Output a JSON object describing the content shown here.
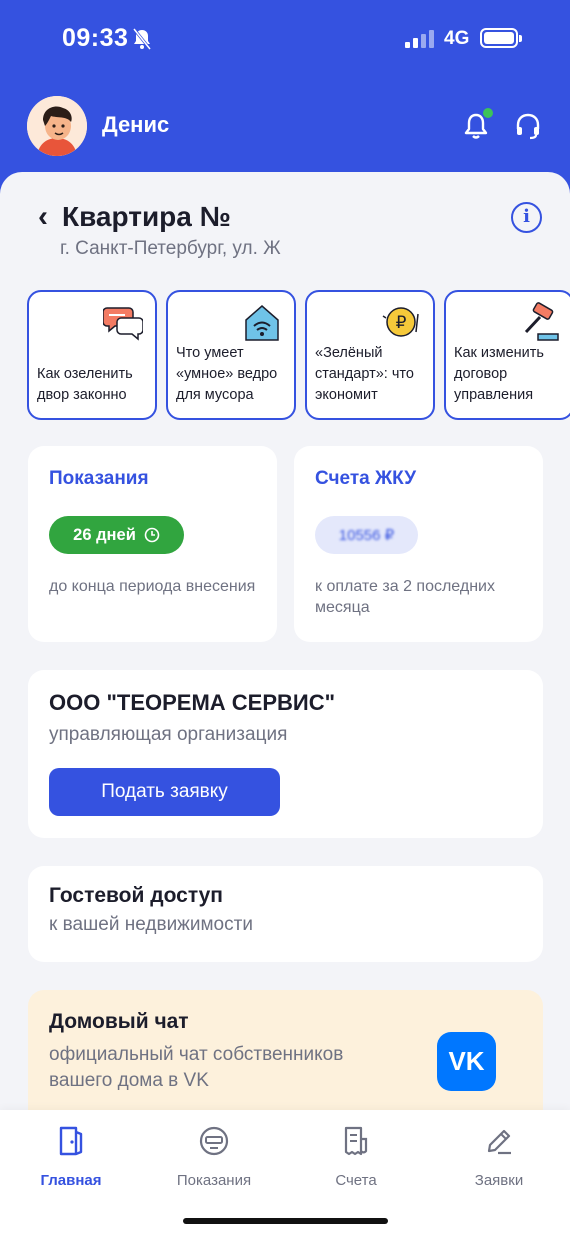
{
  "status_bar": {
    "time": "09:33",
    "network": "4G",
    "icons": [
      "bell-off-icon",
      "signal-icon",
      "battery-icon"
    ]
  },
  "header": {
    "user_name": "Денис",
    "icons": [
      "notification-bell-icon",
      "support-headset-icon"
    ]
  },
  "property": {
    "title": "Квартира №",
    "address": "г. Санкт-Петербург, ул. Ж"
  },
  "stories": [
    {
      "text": "Как озеленить двор законно",
      "icon": "chat-bubbles-icon"
    },
    {
      "text": "Что умеет «умное» ведро для мусора",
      "icon": "smart-home-icon"
    },
    {
      "text": "«Зелёный стандарт»: что экономит",
      "icon": "ruble-coin-icon"
    },
    {
      "text": "Как изменить договор управления",
      "icon": "gavel-icon"
    }
  ],
  "meters": {
    "title": "Показания",
    "days": "26 дней",
    "subtitle": "до конца периода внесения"
  },
  "bills": {
    "title": "Счета ЖКУ",
    "amount": "10556 ₽",
    "subtitle": "к оплате за 2 последних месяца"
  },
  "organization": {
    "name": "ООО \"ТЕОРЕМА СЕРВИС\"",
    "role": "управляющая организация",
    "button": "Подать заявку"
  },
  "guest": {
    "title": "Гостевой доступ",
    "subtitle": "к вашей недвижимости"
  },
  "chat": {
    "title": "Домовый чат",
    "subtitle": "официальный чат собственников вашего дома в VK",
    "vk_label": "VK"
  },
  "nav": [
    {
      "label": "Главная",
      "icon": "door-icon",
      "active": true
    },
    {
      "label": "Показания",
      "icon": "meter-icon",
      "active": false
    },
    {
      "label": "Счета",
      "icon": "receipt-icon",
      "active": false
    },
    {
      "label": "Заявки",
      "icon": "pencil-icon",
      "active": false
    }
  ],
  "colors": {
    "brand": "#3552e0",
    "success": "#31a53f",
    "chat_bg": "#fdf1dc",
    "vk": "#0077ff"
  }
}
